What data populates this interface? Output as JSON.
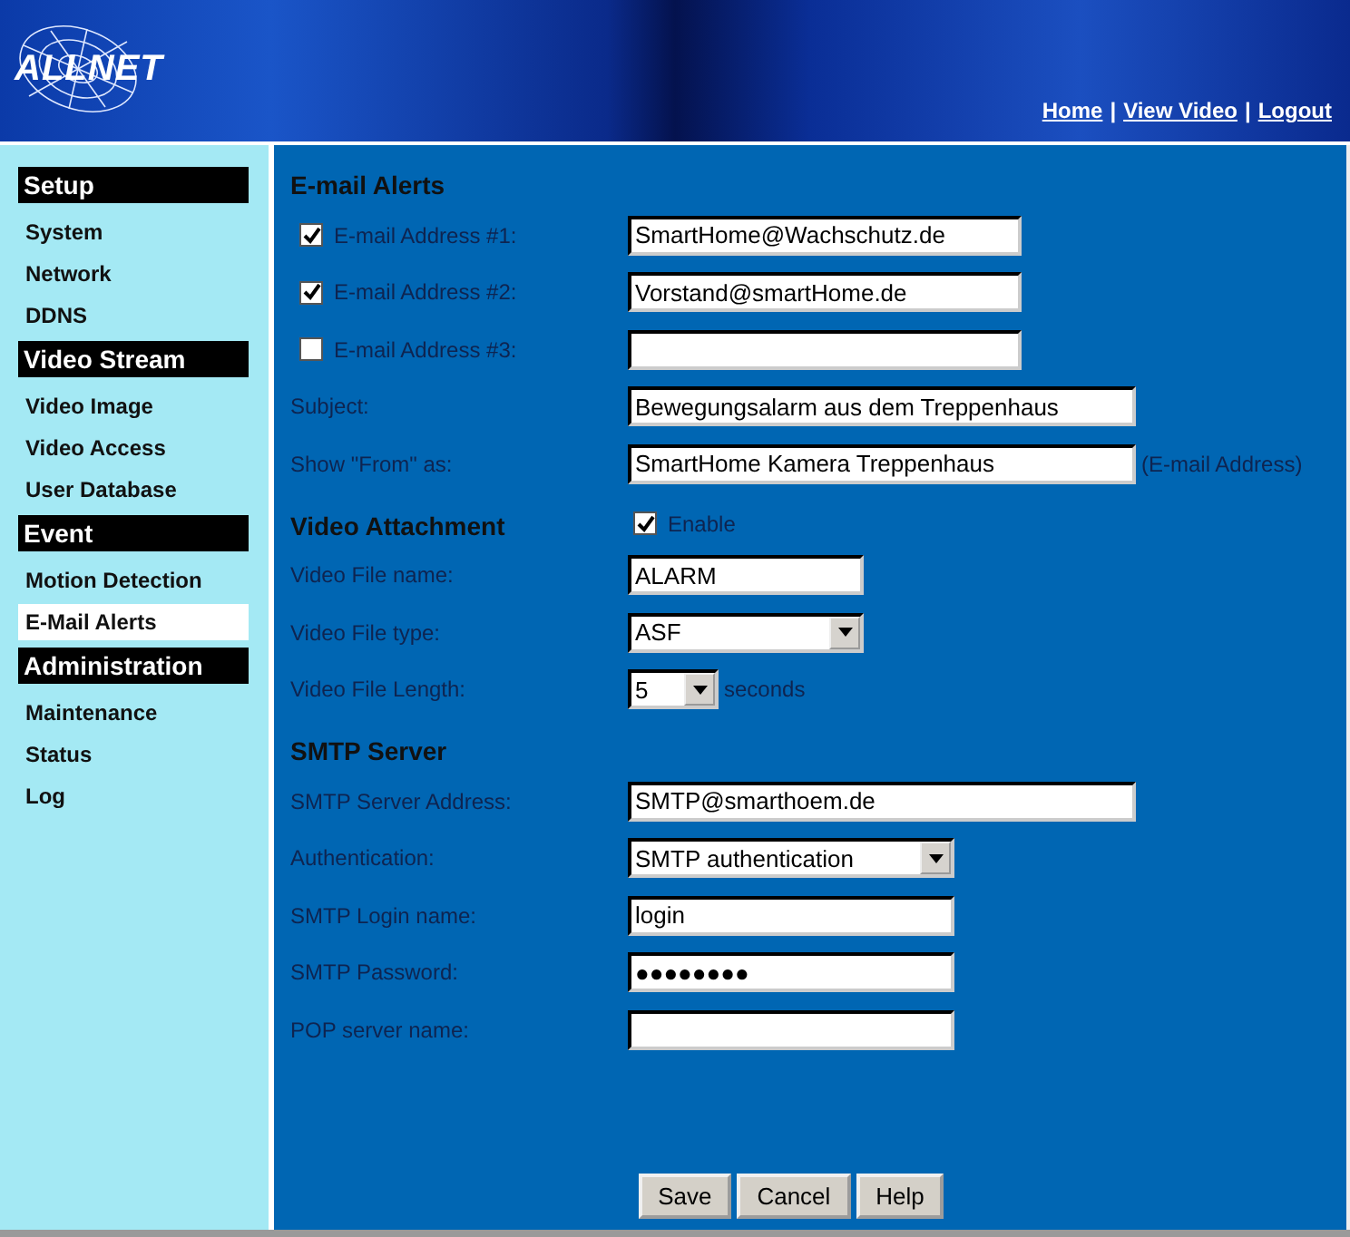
{
  "header": {
    "logo": "ALLNET",
    "links": [
      {
        "label": "Home"
      },
      {
        "separator": "|",
        "label": "View Video"
      },
      {
        "separator": "|",
        "label": "Logout"
      }
    ]
  },
  "sidebar": [
    {
      "heading": "Setup",
      "items": [
        {
          "label": "System",
          "selected": false
        },
        {
          "label": "Network",
          "selected": false
        },
        {
          "label": "DDNS",
          "selected": false
        }
      ]
    },
    {
      "heading": "Video Stream",
      "items": [
        {
          "label": "Video Image",
          "selected": false
        },
        {
          "label": "Video Access",
          "selected": false
        },
        {
          "label": "User Database",
          "selected": false
        }
      ]
    },
    {
      "heading": "Event",
      "items": [
        {
          "label": "Motion Detection",
          "selected": false
        },
        {
          "label": "E-Mail Alerts",
          "selected": true
        }
      ]
    },
    {
      "heading": "Administration",
      "items": [
        {
          "label": "Maintenance",
          "selected": false
        },
        {
          "label": "Status",
          "selected": false
        },
        {
          "label": "Log",
          "selected": false
        }
      ]
    }
  ],
  "sections": [
    {
      "title": "E-mail Alerts",
      "rows": [
        {
          "kind": "check-input",
          "label": "E-mail Address #1:",
          "checked": true,
          "value": "SmartHome@Wachschutz.de"
        },
        {
          "kind": "check-input",
          "label": "E-mail Address #2:",
          "checked": true,
          "value": "Vorstand@smartHome.de"
        },
        {
          "kind": "check-input",
          "label": "E-mail Address #3:",
          "checked": false
        },
        {
          "kind": "input",
          "label": "Subject:",
          "value": "Bewegungsalarm aus dem Treppenhaus"
        },
        {
          "kind": "input",
          "label": "Show \"From\" as:",
          "value": "SmartHome Kamera Treppenhaus",
          "suffix": "(E-mail Address)"
        }
      ]
    },
    {
      "title": "Video Attachment",
      "enable": {
        "label": "Enable",
        "checked": true
      },
      "rows": [
        {
          "kind": "input",
          "label": "Video File name:",
          "value": "ALARM"
        },
        {
          "kind": "select",
          "label": "Video File type:",
          "value": "ASF"
        },
        {
          "kind": "select",
          "label": "Video File Length:",
          "value": "5",
          "suffix": "seconds"
        }
      ]
    },
    {
      "title": "SMTP Server",
      "rows": [
        {
          "kind": "input",
          "label": "SMTP Server Address:",
          "value": "SMTP@smarthoem.de"
        },
        {
          "kind": "select",
          "label": "Authentication:",
          "value": "SMTP authentication"
        },
        {
          "kind": "input",
          "label": "SMTP Login name:",
          "value": "login"
        },
        {
          "kind": "input",
          "label": "SMTP Password:",
          "value": "●●●●●●●●"
        },
        {
          "kind": "input",
          "label": "POP server name:"
        }
      ]
    }
  ],
  "buttons": [
    "Save",
    "Cancel",
    "Help"
  ]
}
